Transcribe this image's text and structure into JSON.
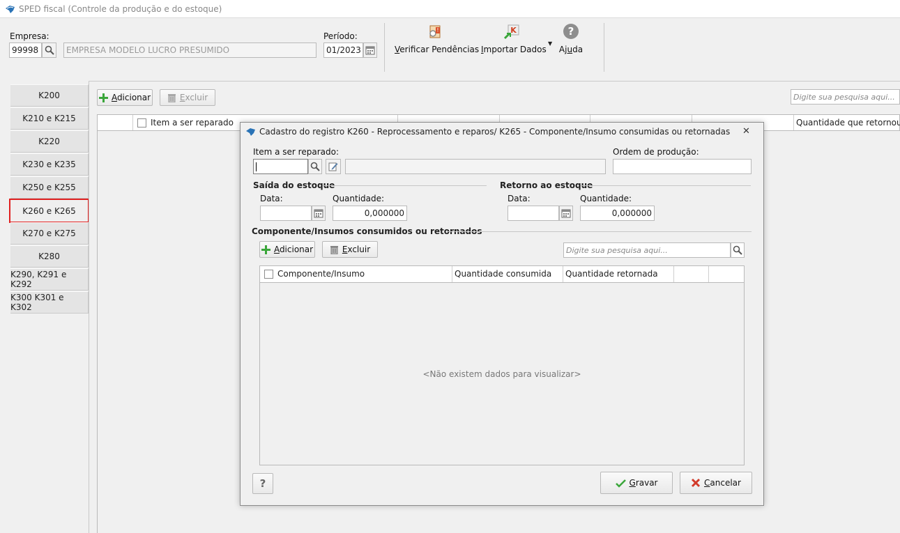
{
  "window": {
    "title": "SPED fiscal (Controle da produção e do estoque)"
  },
  "header": {
    "empresa_label": "Empresa:",
    "empresa_code": "99998",
    "empresa_name": "EMPRESA MODELO LUCRO PRESUMIDO",
    "periodo_label": "Período:",
    "periodo_value": "01/2023"
  },
  "toolbar": {
    "verificar_first": "V",
    "verificar_rest": "erificar Pendências",
    "importar_first": "I",
    "importar_rest": "mportar Dados",
    "ajuda_a": "Aj",
    "ajuda_u": "u",
    "ajuda_b": "da"
  },
  "tabs": [
    "K200",
    "K210 e K215",
    "K220",
    "K230 e K235",
    "K250 e K255",
    "K260 e K265",
    "K270 e K275",
    "K280",
    "K290, K291 e K292",
    "K300 K301 e K302"
  ],
  "main": {
    "add_first": "A",
    "add_rest": "dicionar",
    "del_first": "E",
    "del_rest": "xcluir",
    "search_placeholder": "Digite sua pesquisa aqui...",
    "col_item": "Item a ser reparado",
    "col_last": "Quantidade que retornou"
  },
  "dialog": {
    "title": "Cadastro do registro K260 - Reprocessamento e reparos/ K265 - Componente/Insumo consumidas ou retornadas",
    "item_label": "Item a ser reparado:",
    "ordem_label": "Ordem de produção:",
    "saida_title": "Saída do estoque",
    "retorno_title": "Retorno ao estoque",
    "data_label": "Data:",
    "quantidade_label": "Quantidade:",
    "saida_qty": "0,000000",
    "retorno_qty": "0,000000",
    "comp_title": "Componente/Insumos consumidos ou retornados",
    "add_first": "A",
    "add_rest": "dicionar",
    "del_first": "E",
    "del_rest": "xcluir",
    "search_placeholder": "Digite sua pesquisa aqui...",
    "col_componente": "Componente/Insumo",
    "col_consumida": "Quantidade consumida",
    "col_retornada": "Quantidade retornada",
    "empty_text": "<Não existem dados para visualizar>",
    "help_label": "?",
    "gravar_first": "G",
    "gravar_rest": "ravar",
    "cancelar_first": "C",
    "cancelar_rest": "ancelar"
  },
  "colors": {
    "accent_red": "#e02020",
    "add_green": "#3aa63a",
    "cancel_red": "#d23a2a"
  }
}
